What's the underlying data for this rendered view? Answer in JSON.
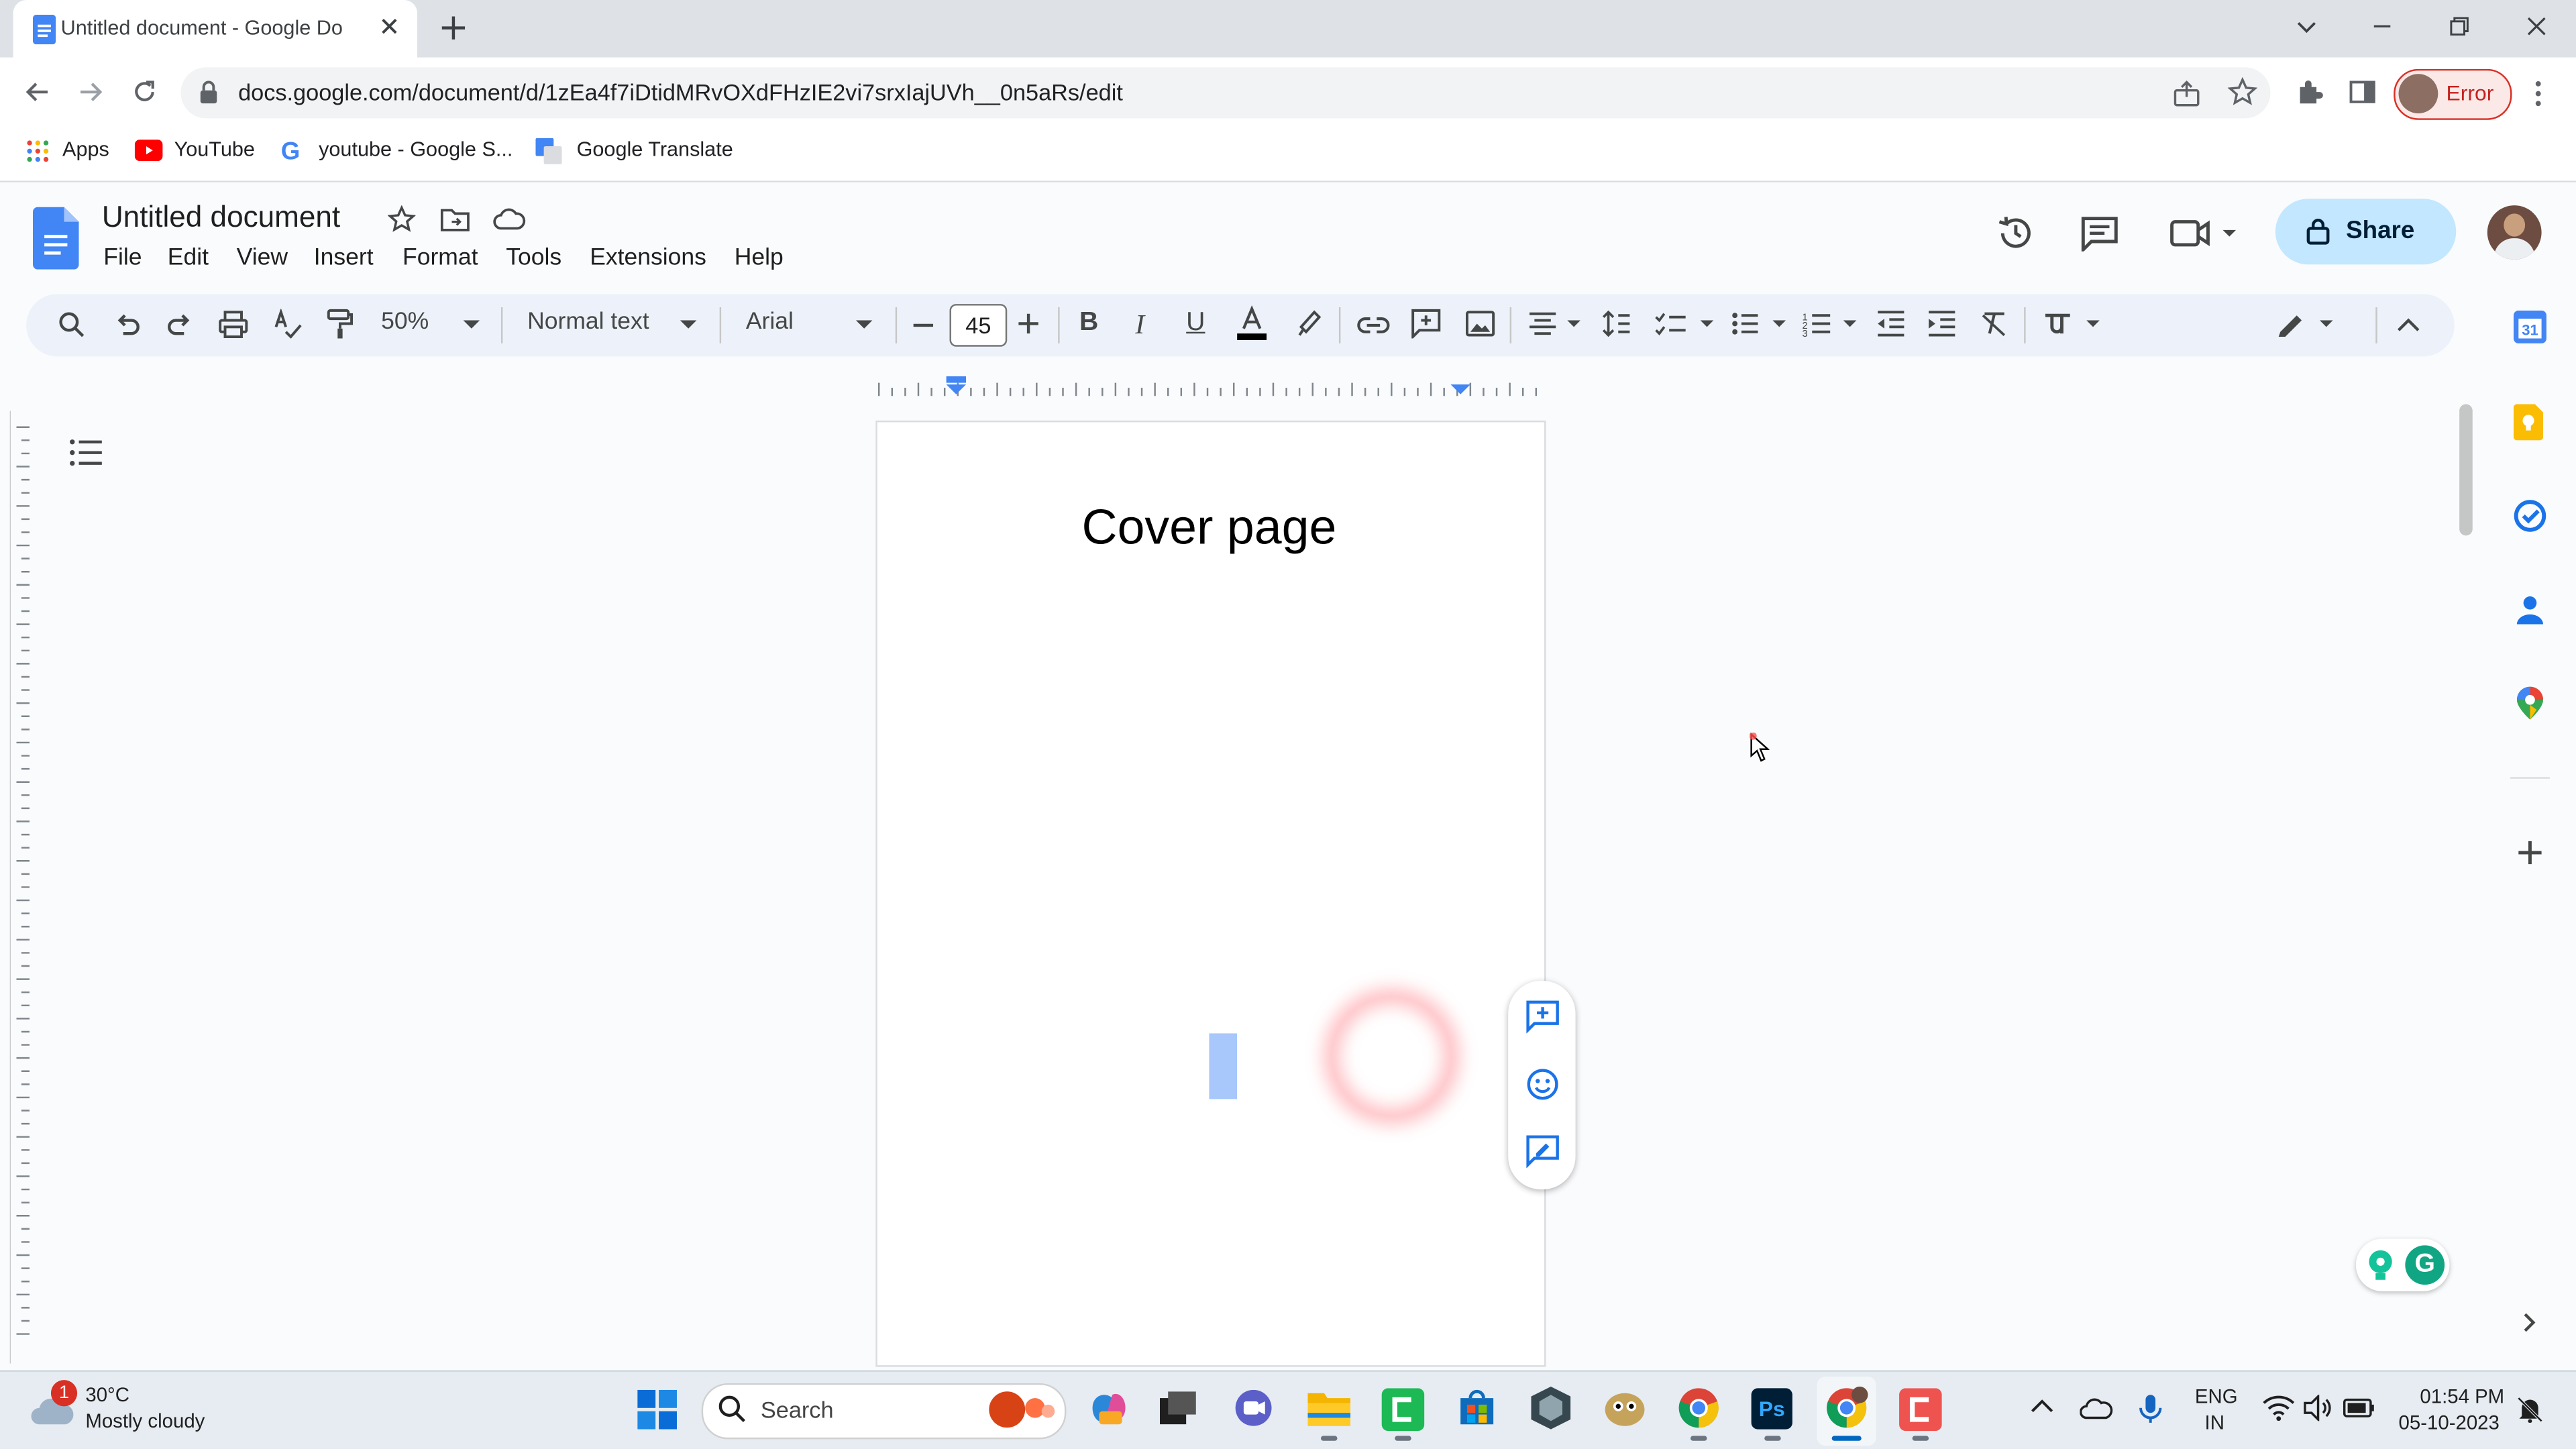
{
  "browser": {
    "tab_title": "Untitled document - Google Do",
    "url": "docs.google.com/document/d/1zEa4f7iDtidMRvOXdFHzIE2vi7srxIajUVh__0n5aRs/edit",
    "profile_status": "Error",
    "bookmarks": [
      "Apps",
      "YouTube",
      "youtube - Google S...",
      "Google Translate"
    ]
  },
  "docs": {
    "title": "Untitled document",
    "menu": [
      "File",
      "Edit",
      "View",
      "Insert",
      "Format",
      "Tools",
      "Extensions",
      "Help"
    ],
    "share_label": "Share",
    "toolbar": {
      "zoom": "50%",
      "style": "Normal text",
      "font": "Arial",
      "font_size": "45"
    },
    "page": {
      "heading": "Cover page"
    }
  },
  "taskbar": {
    "weather_temp": "30°C",
    "weather_desc": "Mostly cloudy",
    "weather_badge": "1",
    "search_label": "Search",
    "lang_top": "ENG",
    "lang_bottom": "IN",
    "time": "01:54 PM",
    "date": "05-10-2023"
  },
  "colors": {
    "accent": "#1a73e8",
    "share_bg": "#c2e7ff",
    "selection": "#a8c7fa",
    "error": "#d93025"
  }
}
